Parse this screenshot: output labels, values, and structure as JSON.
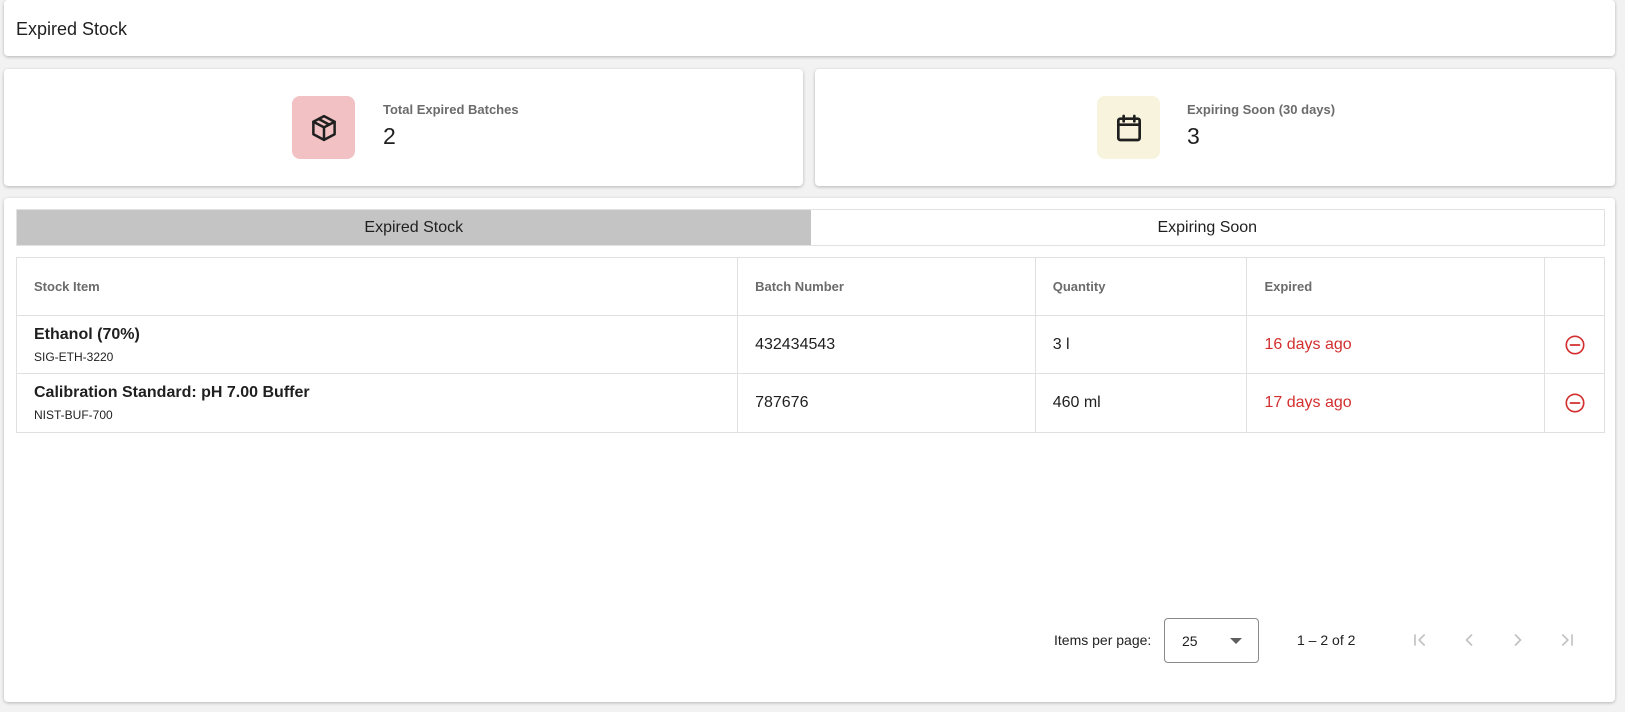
{
  "header": {
    "title": "Expired Stock"
  },
  "stats": {
    "expired": {
      "label": "Total Expired Batches",
      "value": "2",
      "icon": "package-icon",
      "color": "#f2c1c3"
    },
    "soon": {
      "label": "Expiring Soon (30 days)",
      "value": "3",
      "icon": "calendar-icon",
      "color": "#f7f3dc"
    }
  },
  "tabs": [
    {
      "label": "Expired Stock",
      "active": true
    },
    {
      "label": "Expiring Soon",
      "active": false
    }
  ],
  "table": {
    "columns": [
      "Stock Item",
      "Batch Number",
      "Quantity",
      "Expired",
      ""
    ],
    "rows": [
      {
        "name": "Ethanol (70%)",
        "code": "SIG-ETH-3220",
        "batch": "432434543",
        "quantity": "3 l",
        "expired": "16 days ago"
      },
      {
        "name": "Calibration Standard: pH 7.00 Buffer",
        "code": "NIST-BUF-700",
        "batch": "787676",
        "quantity": "460 ml",
        "expired": "17 days ago"
      }
    ]
  },
  "paginator": {
    "items_per_page_label": "Items per page:",
    "page_size": "25",
    "range_label": "1 – 2 of 2"
  },
  "colors": {
    "danger": "#d32f2f",
    "active_tab": "#c4c4c4"
  }
}
